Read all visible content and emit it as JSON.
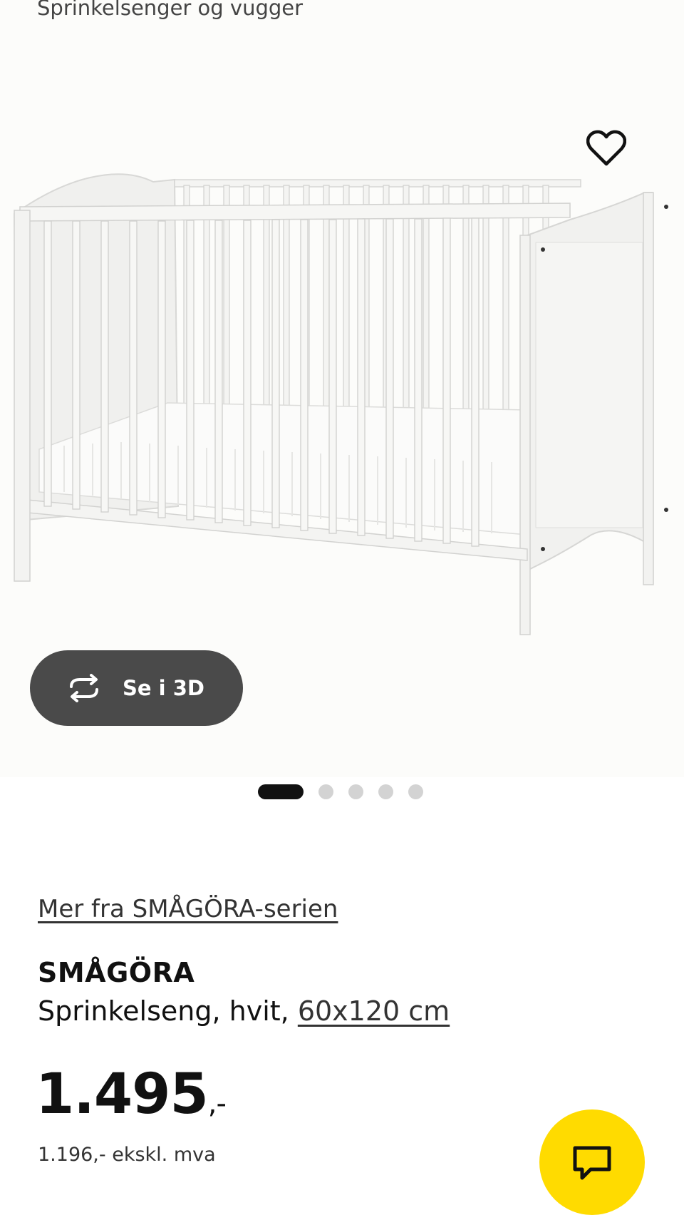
{
  "breadcrumb": {
    "label": "Sprinkelsenger og vugger"
  },
  "gallery": {
    "favorite_icon": "heart-outline-icon",
    "view_3d_icon": "rotate-3d-icon",
    "view_3d_label": "Se i 3D",
    "dots": 5,
    "active_dot": 0
  },
  "product": {
    "series_link": "Mer fra SMÅGÖRA-serien",
    "name": "SMÅGÖRA",
    "description": "Sprinkelseng, hvit, ",
    "size_link": "60x120 cm",
    "price": "1.495",
    "price_suffix": ",-",
    "price_ex_vat": "1.196,- ekskl. mva"
  },
  "chat": {
    "icon": "chat-bubble-icon"
  },
  "colors": {
    "accent_yellow": "#ffdb00",
    "button_dark": "#4a4a4a",
    "dot_active": "#111111",
    "dot_inactive": "#d3d3d3"
  }
}
